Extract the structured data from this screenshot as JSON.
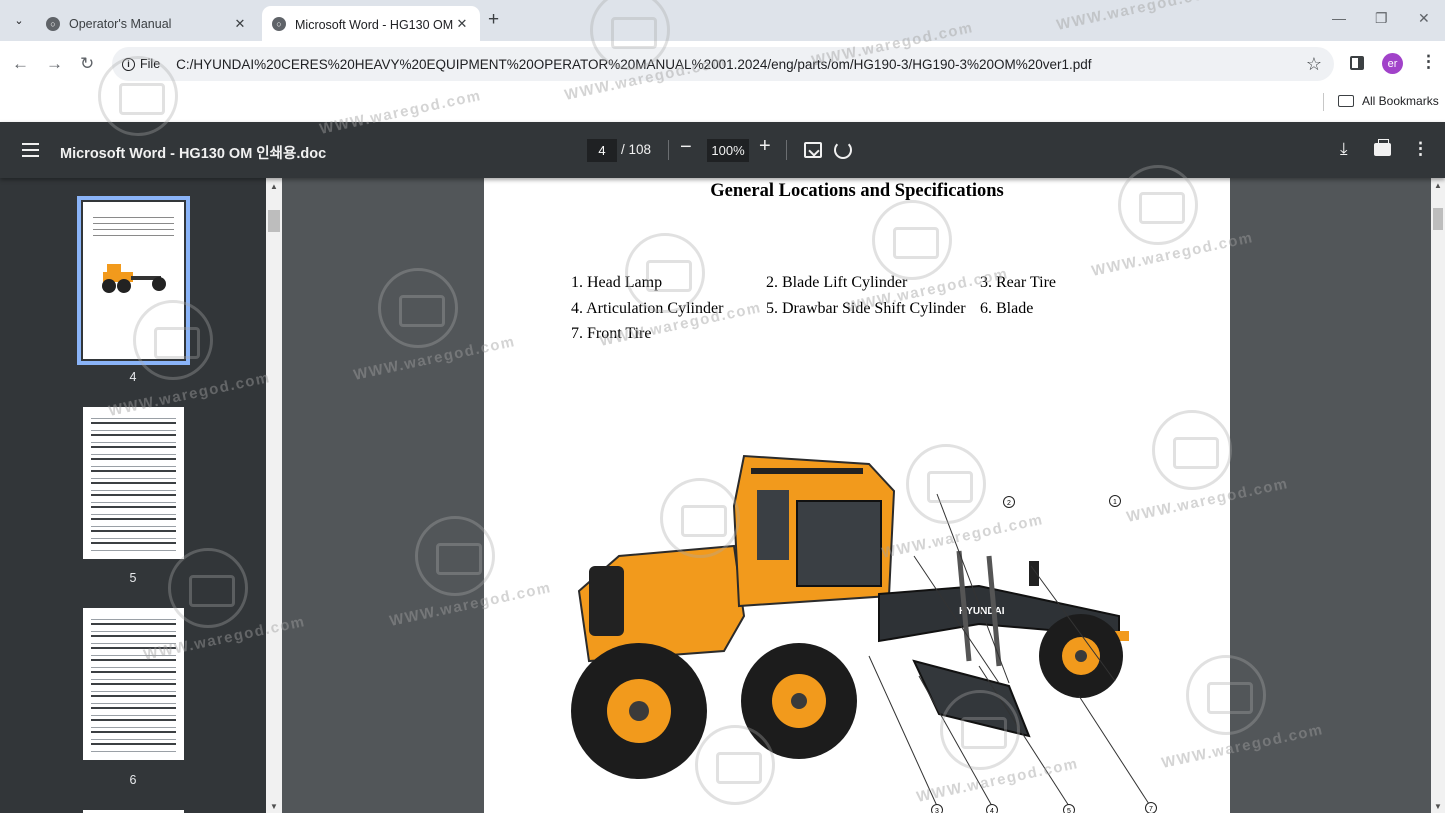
{
  "browser": {
    "tabs": [
      {
        "title": "Operator's Manual",
        "active": false
      },
      {
        "title": "Microsoft Word - HG130 OM 인",
        "active": true
      }
    ],
    "new_tab": "+",
    "site_info_label": "File",
    "url": "C:/HYUNDAI%20CERES%20HEAVY%20EQUIPMENT%20OPERATOR%20MANUAL%2001.2024/eng/parts/om/HG190-3/HG190-3%20OM%20ver1.pdf",
    "profile_initials": "er",
    "bookmarks_label": "All Bookmarks"
  },
  "pdf_viewer": {
    "doc_title": "Microsoft Word - HG130 OM 인쇄용.doc",
    "current_page": "4",
    "total_pages": "/ 108",
    "zoom": "100%"
  },
  "thumbnails": [
    {
      "label": "4",
      "selected": true
    },
    {
      "label": "5",
      "selected": false
    },
    {
      "label": "6",
      "selected": false
    }
  ],
  "page": {
    "heading": "General Locations and Specifications",
    "legend": [
      "1. Head Lamp",
      "2. Blade Lift Cylinder",
      "3. Rear Tire",
      "4. Articulation Cylinder",
      "5. Drawbar Side Shift Cylinder",
      "6. Blade",
      "7. Front Tire"
    ],
    "machine_brand": "HYUNDAI",
    "callouts": [
      "1",
      "2",
      "3",
      "4",
      "5",
      "6",
      "7"
    ]
  },
  "watermark": {
    "text": "WWW.waregod.com"
  },
  "icons": {
    "tab_list": "chevron-down-icon",
    "back": "back-arrow-icon",
    "forward": "forward-arrow-icon",
    "reload": "reload-icon",
    "bookmark_star": "star-icon",
    "menu": "hamburger-icon",
    "download": "download-icon",
    "print": "print-icon"
  },
  "colors": {
    "viewer_background": "#525659",
    "viewer_toolbar": "#323639",
    "thumbnail_selection": "#8ab4f8",
    "machine_body": "#f29a1c",
    "avatar": "#a142c9"
  }
}
